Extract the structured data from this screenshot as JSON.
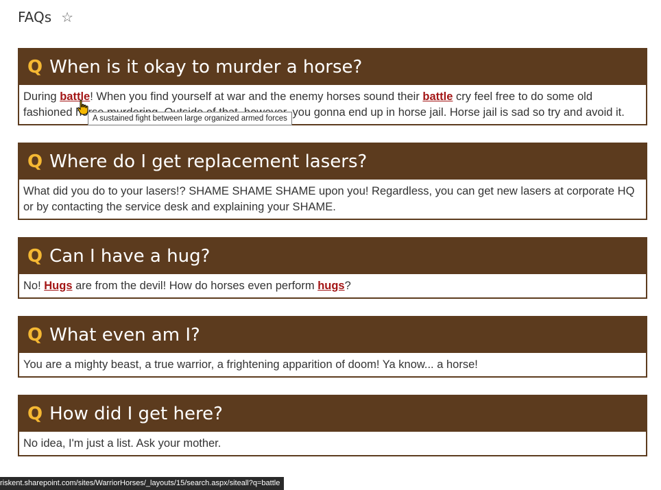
{
  "page": {
    "title": "FAQs",
    "follow_icon": "star-icon"
  },
  "faqs": [
    {
      "q_label": "Q",
      "question": "When is it okay to murder a horse?",
      "answer_parts": [
        "During ",
        "battle",
        "! When you find yourself at war and the enemy horses sound their ",
        "battle",
        " cry feel free to do some old fashioned horse murdering. Outside of that, however, you gonna end up in horse jail. Horse jail is sad so try and avoid it."
      ]
    },
    {
      "q_label": "Q",
      "question": "Where do I get replacement lasers?",
      "answer": "What did you do to your lasers!? SHAME SHAME SHAME upon you! Regardless, you can get new lasers at corporate HQ or by contacting the service desk and explaining your SHAME."
    },
    {
      "q_label": "Q",
      "question": "Can I have a hug?",
      "answer_parts": [
        "No! ",
        "Hugs",
        " are from the devil! How do horses even perform ",
        "hugs",
        "?"
      ]
    },
    {
      "q_label": "Q",
      "question": "What even am I?",
      "answer": "You are a mighty beast, a true warrior, a frightening apparition of doom! Ya know... a horse!"
    },
    {
      "q_label": "Q",
      "question": "How did I get here?",
      "answer": "No idea, I'm just a list. Ask your mother."
    }
  ],
  "tooltip": "A sustained fight between large organized armed forces",
  "status_bar": "riskent.sharepoint.com/sites/WarriorHorses/_layouts/15/search.aspx/siteall?q=battle",
  "colors": {
    "header_bg": "#5c3b1e",
    "q_accent": "#f5b833",
    "keyword": "#a31515"
  }
}
